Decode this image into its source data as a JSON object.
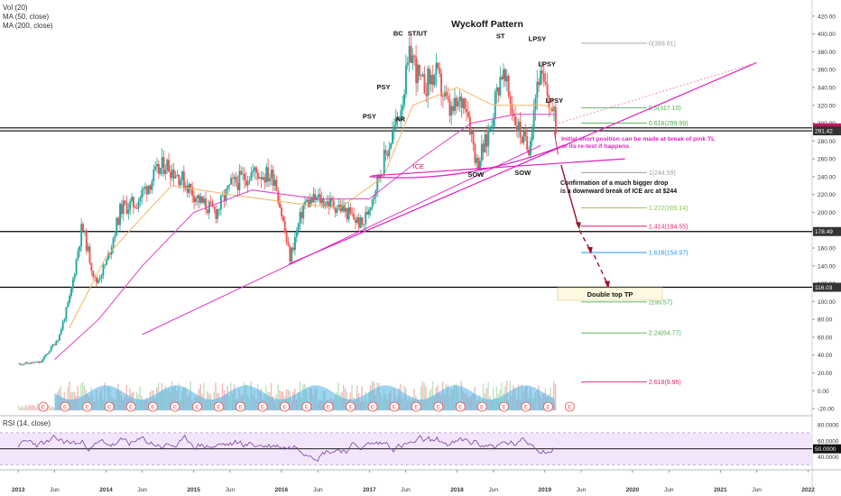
{
  "indicators": {
    "vol": "Vol (20)",
    "ma50": "MA (50, close)",
    "ma200": "MA (200, close)",
    "rsi": "RSI (14, close)"
  },
  "colors": {
    "up": "#26a69a",
    "down": "#ef5350",
    "ma50": "#f5b461",
    "ma200": "#e040c0",
    "trend": "#e020c0",
    "arrow": "#a0102a",
    "rsi": "#7b3fa0",
    "rsi_band": "#f3e6fb",
    "vol": "#4fb3e6"
  },
  "chart_data": {
    "type": "candlestick",
    "title": "Wyckoff Pattern",
    "x_ticks": [
      "2013",
      "Jun",
      "2014",
      "Jun",
      "2015",
      "Jun",
      "2016",
      "Jun",
      "2017",
      "Jun",
      "2018",
      "Jun",
      "2019",
      "Jun",
      "2020",
      "Jun",
      "2021",
      "Jun",
      "2022"
    ],
    "y_ticks": [
      "420.00",
      "400.00",
      "380.00",
      "360.00",
      "340.00",
      "320.00",
      "300.00",
      "280.00",
      "260.00",
      "240.00",
      "220.00",
      "200.00",
      "180.00",
      "160.00",
      "140.00",
      "120.00",
      "100.00",
      "80.00",
      "60.00",
      "40.00",
      "20.00",
      "0.00",
      "-20.00"
    ],
    "rsi_ticks": [
      "80.0000",
      "60.0000",
      "40.0000"
    ],
    "ylim": [
      -25,
      430
    ],
    "price_path": [
      [
        "2013-01-01",
        30
      ],
      [
        "2013-04-01",
        32
      ],
      [
        "2013-06-15",
        60
      ],
      [
        "2013-08-01",
        105
      ],
      [
        "2013-09-20",
        185
      ],
      [
        "2013-10-20",
        150
      ],
      [
        "2013-11-15",
        120
      ],
      [
        "2014-01-01",
        145
      ],
      [
        "2014-03-01",
        205
      ],
      [
        "2014-05-01",
        210
      ],
      [
        "2014-07-01",
        235
      ],
      [
        "2014-09-01",
        255
      ],
      [
        "2014-11-01",
        240
      ],
      [
        "2015-02-01",
        210
      ],
      [
        "2015-04-01",
        200
      ],
      [
        "2015-06-01",
        230
      ],
      [
        "2015-09-01",
        245
      ],
      [
        "2015-12-01",
        240
      ],
      [
        "2016-02-01",
        148
      ],
      [
        "2016-04-01",
        210
      ],
      [
        "2016-06-01",
        215
      ],
      [
        "2016-09-01",
        205
      ],
      [
        "2016-12-01",
        185
      ],
      [
        "2017-03-01",
        260
      ],
      [
        "2017-05-01",
        310
      ],
      [
        "2017-06-20",
        380
      ],
      [
        "2017-08-01",
        340
      ],
      [
        "2017-10-01",
        355
      ],
      [
        "2017-12-01",
        310
      ],
      [
        "2018-02-01",
        330
      ],
      [
        "2018-03-20",
        255
      ],
      [
        "2018-05-01",
        280
      ],
      [
        "2018-07-01",
        360
      ],
      [
        "2018-09-01",
        300
      ],
      [
        "2018-10-20",
        270
      ],
      [
        "2018-12-01",
        355
      ],
      [
        "2019-01-10",
        330
      ],
      [
        "2019-02-15",
        295
      ]
    ],
    "ma50_path": [
      [
        "2013-08-01",
        70
      ],
      [
        "2014-01-01",
        150
      ],
      [
        "2014-06-01",
        195
      ],
      [
        "2014-10-01",
        230
      ],
      [
        "2015-06-01",
        220
      ],
      [
        "2016-03-01",
        210
      ],
      [
        "2016-09-01",
        205
      ],
      [
        "2017-03-01",
        240
      ],
      [
        "2017-07-01",
        320
      ],
      [
        "2018-01-01",
        340
      ],
      [
        "2018-06-01",
        320
      ],
      [
        "2019-01-01",
        320
      ],
      [
        "2019-02-15",
        315
      ]
    ],
    "ma200_path": [
      [
        "2013-06-01",
        35
      ],
      [
        "2013-12-01",
        80
      ],
      [
        "2014-06-01",
        140
      ],
      [
        "2015-01-01",
        200
      ],
      [
        "2015-09-01",
        225
      ],
      [
        "2016-06-01",
        215
      ],
      [
        "2017-01-01",
        215
      ],
      [
        "2017-08-01",
        260
      ],
      [
        "2018-03-01",
        300
      ],
      [
        "2018-09-01",
        310
      ],
      [
        "2019-02-15",
        310
      ]
    ],
    "horizontal_levels": [
      {
        "value": 294.71,
        "label": "294.71",
        "color": "#c2185b"
      },
      {
        "value": 291.42,
        "label": "291.42",
        "color": "#333333"
      },
      {
        "value": 178.49,
        "label": "178.49",
        "color": "#333333"
      },
      {
        "value": 116.03,
        "label": "116.03",
        "color": "#333333"
      }
    ],
    "fib_levels": [
      {
        "label": "0(389.61)",
        "value": 389.61,
        "color": "#9e9e9e"
      },
      {
        "label": "0.5(317.10)",
        "value": 317.1,
        "color": "#4caf50"
      },
      {
        "label": "0.618(299.99)",
        "value": 299.99,
        "color": "#4caf50"
      },
      {
        "label": "1(244.59)",
        "value": 244.59,
        "color": "#9e9e9e"
      },
      {
        "label": "1.272(205.14)",
        "value": 205.14,
        "color": "#8bc34a"
      },
      {
        "label": "1.414(184.55)",
        "value": 184.55,
        "color": "#e91e63"
      },
      {
        "label": "1.618(154.97)",
        "value": 154.97,
        "color": "#2196f3"
      },
      {
        "label": "2(99.57)",
        "value": 99.57,
        "color": "#4caf50"
      },
      {
        "label": "2.24(64.77)",
        "value": 64.77,
        "color": "#4caf50"
      },
      {
        "label": "2.618(9.95)",
        "value": 9.95,
        "color": "#e91e63"
      }
    ],
    "annotations": [
      {
        "text": "BC",
        "x": "2017-05-01",
        "y": 398
      },
      {
        "text": "ST/UT",
        "x": "2017-07-20",
        "y": 398
      },
      {
        "text": "ST",
        "x": "2018-07-01",
        "y": 395
      },
      {
        "text": "LPSY",
        "x": "2018-12-01",
        "y": 392
      },
      {
        "text": "LPSY",
        "x": "2019-01-10",
        "y": 364
      },
      {
        "text": "PSY",
        "x": "2017-03-01",
        "y": 338
      },
      {
        "text": "LPSY",
        "x": "2019-02-10",
        "y": 323
      },
      {
        "text": "PSY",
        "x": "2017-01-01",
        "y": 305
      },
      {
        "text": "AR",
        "x": "2017-05-10",
        "y": 302
      },
      {
        "text": "SOW",
        "x": "2018-03-20",
        "y": 240
      },
      {
        "text": "SOW",
        "x": "2018-10-01",
        "y": 242
      }
    ],
    "ice_label": "ICE",
    "note_pink": [
      "Initial short position can be made at break of pink TL",
      "or its re-test if happens"
    ],
    "note_black": [
      "Confirmation of a much bigger drop",
      "is a downward break of ICE arc at $244"
    ],
    "target_box": "Double top TP",
    "earnings_marker": "E",
    "earnings_dates": [
      "2013-04-15",
      "2013-07-15",
      "2013-10-15",
      "2014-01-15",
      "2014-04-15",
      "2014-07-15",
      "2014-10-15",
      "2015-01-15",
      "2015-04-15",
      "2015-07-15",
      "2015-10-15",
      "2016-01-15",
      "2016-04-15",
      "2016-07-15",
      "2016-10-15",
      "2017-01-15",
      "2017-04-15",
      "2017-07-15",
      "2017-10-15",
      "2018-01-15",
      "2018-04-15",
      "2018-07-15",
      "2018-10-15",
      "2019-01-15",
      "2019-04-15"
    ],
    "rsi_last": "50.0000"
  }
}
